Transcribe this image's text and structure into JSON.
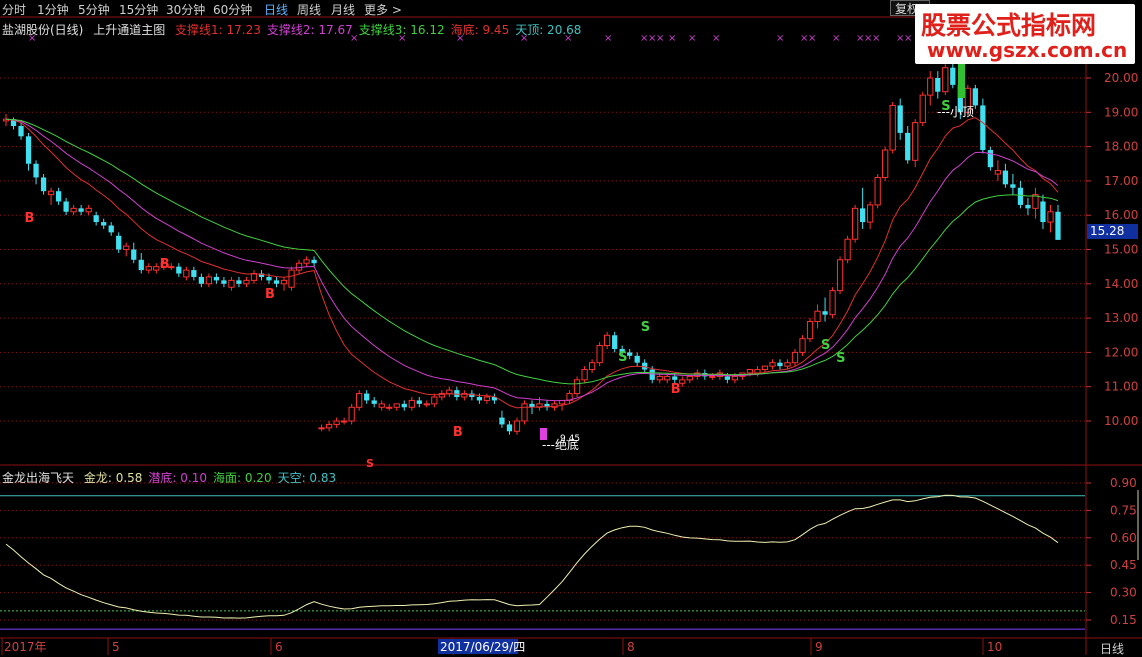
{
  "toolbar": {
    "items": [
      "分时",
      "1分钟",
      "5分钟",
      "15分钟",
      "30分钟",
      "60分钟",
      "日线",
      "周线",
      "月线",
      "更多 >"
    ],
    "active_index": 6,
    "fuquan_label": "复权"
  },
  "watermark": {
    "title": "股票公式指标网",
    "url": "www.gszx.com.cn"
  },
  "main_legend": {
    "stock_label": "盐湖股份(日线)",
    "indicator_name": "上升通道主图",
    "items": [
      {
        "label": "支撑线1:",
        "value": "17.23",
        "color": "#e03030"
      },
      {
        "label": "支撑线2:",
        "value": "17.67",
        "color": "#d040d0"
      },
      {
        "label": "支撑线3:",
        "value": "16.12",
        "color": "#40d040"
      },
      {
        "label": "海底:",
        "value": "9.45",
        "color": "#e03030"
      },
      {
        "label": "天顶:",
        "value": "20.68",
        "color": "#40c0c0"
      }
    ]
  },
  "sub_legend": {
    "indicator_name": "金龙出海飞天",
    "items": [
      {
        "label": "金龙:",
        "value": "0.58",
        "color": "#e0e0a0"
      },
      {
        "label": "潜底:",
        "value": "0.10",
        "color": "#d040d0"
      },
      {
        "label": "海面:",
        "value": "0.20",
        "color": "#40d040"
      },
      {
        "label": "天空:",
        "value": "0.83",
        "color": "#40c0c0"
      }
    ]
  },
  "price_axis": [
    "20.00",
    "19.00",
    "18.00",
    "17.00",
    "16.00",
    "15.00",
    "14.00",
    "13.00",
    "12.00",
    "11.00",
    "10.00"
  ],
  "current_price": "15.28",
  "high_label": "20.68",
  "sub_axis": [
    "0.90",
    "0.75",
    "0.60",
    "0.45",
    "0.30",
    "0.15"
  ],
  "date_axis": [
    "2017年",
    "5",
    "6",
    "7",
    "8",
    "9",
    "10"
  ],
  "cursor_date": "2017/06/29/四",
  "period_label": "日线",
  "annotations": {
    "bottom_label": "---绝底",
    "top_label": "---小顶",
    "buy_marker": "B",
    "sell_marker": "S",
    "low_price": "9.45"
  },
  "colors": {
    "up": "#ff3030",
    "down": "#40e0f0",
    "ma_red": "#e03030",
    "ma_magenta": "#d040d0",
    "ma_green": "#40d040",
    "grid": "#8b1010",
    "dragon": "#f0f0b0",
    "sky": "#40c0c0"
  },
  "chart_data": {
    "type": "candlestick",
    "price_range": [
      9.45,
      20.68
    ],
    "candles": [
      [
        18.75,
        18.95,
        18.6,
        18.8
      ],
      [
        18.8,
        18.85,
        18.5,
        18.6
      ],
      [
        18.6,
        18.7,
        18.2,
        18.3
      ],
      [
        18.3,
        18.4,
        17.3,
        17.5
      ],
      [
        17.5,
        17.6,
        16.9,
        17.1
      ],
      [
        17.1,
        17.2,
        16.6,
        16.7
      ],
      [
        16.6,
        16.8,
        16.3,
        16.7
      ],
      [
        16.7,
        16.8,
        16.3,
        16.4
      ],
      [
        16.4,
        16.5,
        16.0,
        16.1
      ],
      [
        16.1,
        16.3,
        16.0,
        16.2
      ],
      [
        16.2,
        16.3,
        16.0,
        16.1
      ],
      [
        16.1,
        16.3,
        16.0,
        16.2
      ],
      [
        16.0,
        16.1,
        15.7,
        15.8
      ],
      [
        15.8,
        15.9,
        15.6,
        15.7
      ],
      [
        15.7,
        15.8,
        15.4,
        15.5
      ],
      [
        15.4,
        15.5,
        14.9,
        15.0
      ],
      [
        15.0,
        15.2,
        14.8,
        15.1
      ],
      [
        15.0,
        15.2,
        14.6,
        14.7
      ],
      [
        14.7,
        14.9,
        14.3,
        14.4
      ],
      [
        14.4,
        14.6,
        14.3,
        14.5
      ],
      [
        14.4,
        14.6,
        14.3,
        14.5
      ],
      [
        14.5,
        14.7,
        14.4,
        14.6
      ],
      [
        14.5,
        14.6,
        14.4,
        14.5
      ],
      [
        14.5,
        14.6,
        14.2,
        14.3
      ],
      [
        14.2,
        14.5,
        14.1,
        14.4
      ],
      [
        14.4,
        14.5,
        14.1,
        14.2
      ],
      [
        14.2,
        14.3,
        13.9,
        14.0
      ],
      [
        14.0,
        14.3,
        13.9,
        14.2
      ],
      [
        14.2,
        14.3,
        14.0,
        14.1
      ],
      [
        14.1,
        14.2,
        13.9,
        14.0
      ],
      [
        13.9,
        14.2,
        13.8,
        14.1
      ],
      [
        14.1,
        14.2,
        13.9,
        14.0
      ],
      [
        14.0,
        14.2,
        13.9,
        14.1
      ],
      [
        14.1,
        14.4,
        14.0,
        14.3
      ],
      [
        14.3,
        14.4,
        14.1,
        14.2
      ],
      [
        14.2,
        14.3,
        14.0,
        14.1
      ],
      [
        14.1,
        14.2,
        13.9,
        14.0
      ],
      [
        14.0,
        14.2,
        13.8,
        14.1
      ],
      [
        13.9,
        14.5,
        13.8,
        14.4
      ],
      [
        14.4,
        14.7,
        14.3,
        14.6
      ],
      [
        14.6,
        14.8,
        14.5,
        14.7
      ],
      [
        14.7,
        14.8,
        14.5,
        14.6
      ],
      [
        9.8,
        9.9,
        9.7,
        9.8
      ],
      [
        9.8,
        10.0,
        9.7,
        9.9
      ],
      [
        9.9,
        10.1,
        9.8,
        10.0
      ],
      [
        10.0,
        10.1,
        9.9,
        10.0
      ],
      [
        10.0,
        10.5,
        9.9,
        10.4
      ],
      [
        10.4,
        10.9,
        10.3,
        10.8
      ],
      [
        10.8,
        10.9,
        10.5,
        10.6
      ],
      [
        10.6,
        10.7,
        10.4,
        10.5
      ],
      [
        10.4,
        10.6,
        10.3,
        10.5
      ],
      [
        10.4,
        10.5,
        10.3,
        10.4
      ],
      [
        10.4,
        10.5,
        10.3,
        10.5
      ],
      [
        10.5,
        10.6,
        10.3,
        10.4
      ],
      [
        10.4,
        10.7,
        10.3,
        10.6
      ],
      [
        10.6,
        10.7,
        10.4,
        10.5
      ],
      [
        10.5,
        10.6,
        10.4,
        10.5
      ],
      [
        10.5,
        10.8,
        10.4,
        10.7
      ],
      [
        10.7,
        10.9,
        10.6,
        10.8
      ],
      [
        10.8,
        11.0,
        10.7,
        10.9
      ],
      [
        10.9,
        11.0,
        10.6,
        10.7
      ],
      [
        10.7,
        10.9,
        10.6,
        10.8
      ],
      [
        10.8,
        10.9,
        10.6,
        10.7
      ],
      [
        10.7,
        10.8,
        10.5,
        10.6
      ],
      [
        10.6,
        10.8,
        10.5,
        10.7
      ],
      [
        10.7,
        10.8,
        10.5,
        10.6
      ],
      [
        10.1,
        10.3,
        9.8,
        9.9
      ],
      [
        9.9,
        10.0,
        9.6,
        9.7
      ],
      [
        9.7,
        10.1,
        9.6,
        10.0
      ],
      [
        10.0,
        10.6,
        9.9,
        10.5
      ],
      [
        10.5,
        10.6,
        10.2,
        10.4
      ],
      [
        10.4,
        10.7,
        10.3,
        10.5
      ],
      [
        10.5,
        10.6,
        10.3,
        10.4
      ],
      [
        10.4,
        10.6,
        10.3,
        10.5
      ],
      [
        10.5,
        10.6,
        10.3,
        10.6
      ],
      [
        10.6,
        10.9,
        10.5,
        10.8
      ],
      [
        10.8,
        11.3,
        10.7,
        11.2
      ],
      [
        11.2,
        11.6,
        11.1,
        11.5
      ],
      [
        11.5,
        11.8,
        11.4,
        11.7
      ],
      [
        11.7,
        12.3,
        11.6,
        12.2
      ],
      [
        12.2,
        12.6,
        12.1,
        12.5
      ],
      [
        12.5,
        12.6,
        12.0,
        12.1
      ],
      [
        12.1,
        12.2,
        11.9,
        12.0
      ],
      [
        12.0,
        12.1,
        11.8,
        11.9
      ],
      [
        11.9,
        12.0,
        11.6,
        11.7
      ],
      [
        11.7,
        11.8,
        11.4,
        11.5
      ],
      [
        11.5,
        11.6,
        11.1,
        11.2
      ],
      [
        11.2,
        11.4,
        11.1,
        11.3
      ],
      [
        11.2,
        11.4,
        11.1,
        11.3
      ],
      [
        11.3,
        11.4,
        11.1,
        11.2
      ],
      [
        11.1,
        11.3,
        11.0,
        11.2
      ],
      [
        11.2,
        11.3,
        11.1,
        11.3
      ],
      [
        11.3,
        11.5,
        11.2,
        11.4
      ],
      [
        11.4,
        11.5,
        11.2,
        11.3
      ],
      [
        11.3,
        11.4,
        11.2,
        11.3
      ],
      [
        11.3,
        11.5,
        11.2,
        11.4
      ],
      [
        11.3,
        11.4,
        11.1,
        11.2
      ],
      [
        11.2,
        11.4,
        11.1,
        11.3
      ],
      [
        11.3,
        11.4,
        11.2,
        11.4
      ],
      [
        11.4,
        11.5,
        11.3,
        11.5
      ],
      [
        11.4,
        11.6,
        11.3,
        11.5
      ],
      [
        11.5,
        11.6,
        11.4,
        11.6
      ],
      [
        11.6,
        11.8,
        11.5,
        11.7
      ],
      [
        11.7,
        11.8,
        11.5,
        11.6
      ],
      [
        11.6,
        11.8,
        11.5,
        11.7
      ],
      [
        11.7,
        12.1,
        11.6,
        12.0
      ],
      [
        12.0,
        12.5,
        11.9,
        12.4
      ],
      [
        12.4,
        13.0,
        12.3,
        12.9
      ],
      [
        12.9,
        13.4,
        12.7,
        13.2
      ],
      [
        13.2,
        13.6,
        12.9,
        13.1
      ],
      [
        13.1,
        13.9,
        13.0,
        13.8
      ],
      [
        13.8,
        14.8,
        13.7,
        14.7
      ],
      [
        14.7,
        15.4,
        14.6,
        15.3
      ],
      [
        15.3,
        16.3,
        15.2,
        16.2
      ],
      [
        16.2,
        16.8,
        15.6,
        15.8
      ],
      [
        15.8,
        16.4,
        15.6,
        16.3
      ],
      [
        16.3,
        17.2,
        16.2,
        17.1
      ],
      [
        17.1,
        18.0,
        17.0,
        17.9
      ],
      [
        17.9,
        19.3,
        17.8,
        19.2
      ],
      [
        19.2,
        19.4,
        18.2,
        18.4
      ],
      [
        18.4,
        18.6,
        17.5,
        17.6
      ],
      [
        17.6,
        18.8,
        17.4,
        18.7
      ],
      [
        18.7,
        19.6,
        18.6,
        19.5
      ],
      [
        19.5,
        20.2,
        19.2,
        20.0
      ],
      [
        20.0,
        20.2,
        19.4,
        19.6
      ],
      [
        19.6,
        20.4,
        19.5,
        20.3
      ],
      [
        20.3,
        20.68,
        19.7,
        19.8
      ],
      [
        19.8,
        20.1,
        18.8,
        19.0
      ],
      [
        19.0,
        19.8,
        18.9,
        19.7
      ],
      [
        19.7,
        19.8,
        19.1,
        19.2
      ],
      [
        19.2,
        19.4,
        17.8,
        17.9
      ],
      [
        17.9,
        18.0,
        17.3,
        17.4
      ],
      [
        17.2,
        17.6,
        17.0,
        17.3
      ],
      [
        17.3,
        17.5,
        16.8,
        16.9
      ],
      [
        16.9,
        17.2,
        16.6,
        16.8
      ],
      [
        16.8,
        17.0,
        16.2,
        16.3
      ],
      [
        16.3,
        16.5,
        16.0,
        16.2
      ],
      [
        16.2,
        16.8,
        15.9,
        16.6
      ],
      [
        16.4,
        16.6,
        15.6,
        15.8
      ],
      [
        15.8,
        16.3,
        15.5,
        16.1
      ],
      [
        16.1,
        16.3,
        15.3,
        15.28
      ]
    ]
  }
}
